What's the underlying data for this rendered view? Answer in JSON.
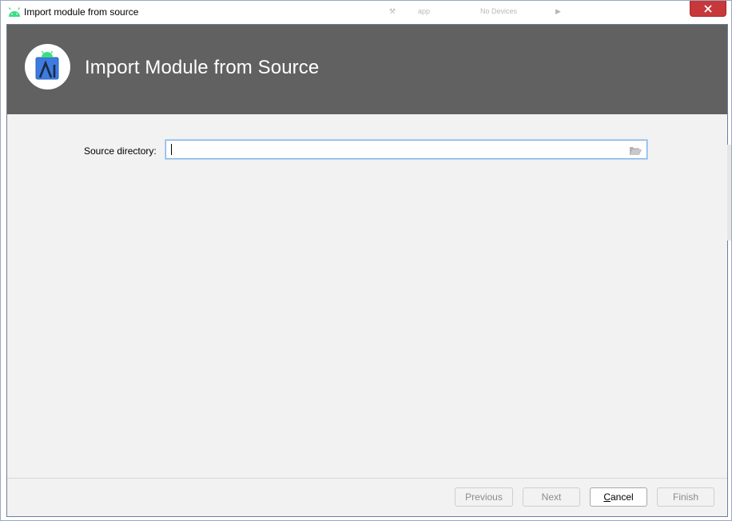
{
  "window": {
    "title": "Import module from source",
    "close_icon": "close-icon",
    "app_icon": "android-icon"
  },
  "background_toolbar": {
    "items": [
      "app",
      "No Devices"
    ]
  },
  "banner": {
    "title": "Import Module from Source",
    "logo_icon": "android-studio-logo",
    "background_color": "#616161"
  },
  "form": {
    "source_directory_label": "Source directory:",
    "source_directory_value": "",
    "browse_icon": "folder-open-icon"
  },
  "buttons": {
    "previous": "Previous",
    "next": "Next",
    "cancel_mnemonic": "C",
    "cancel_rest": "ancel",
    "finish": "Finish"
  },
  "colors": {
    "close_button": "#c7383a",
    "focus_border": "#7fb2e6",
    "android_green": "#3ddc84"
  }
}
